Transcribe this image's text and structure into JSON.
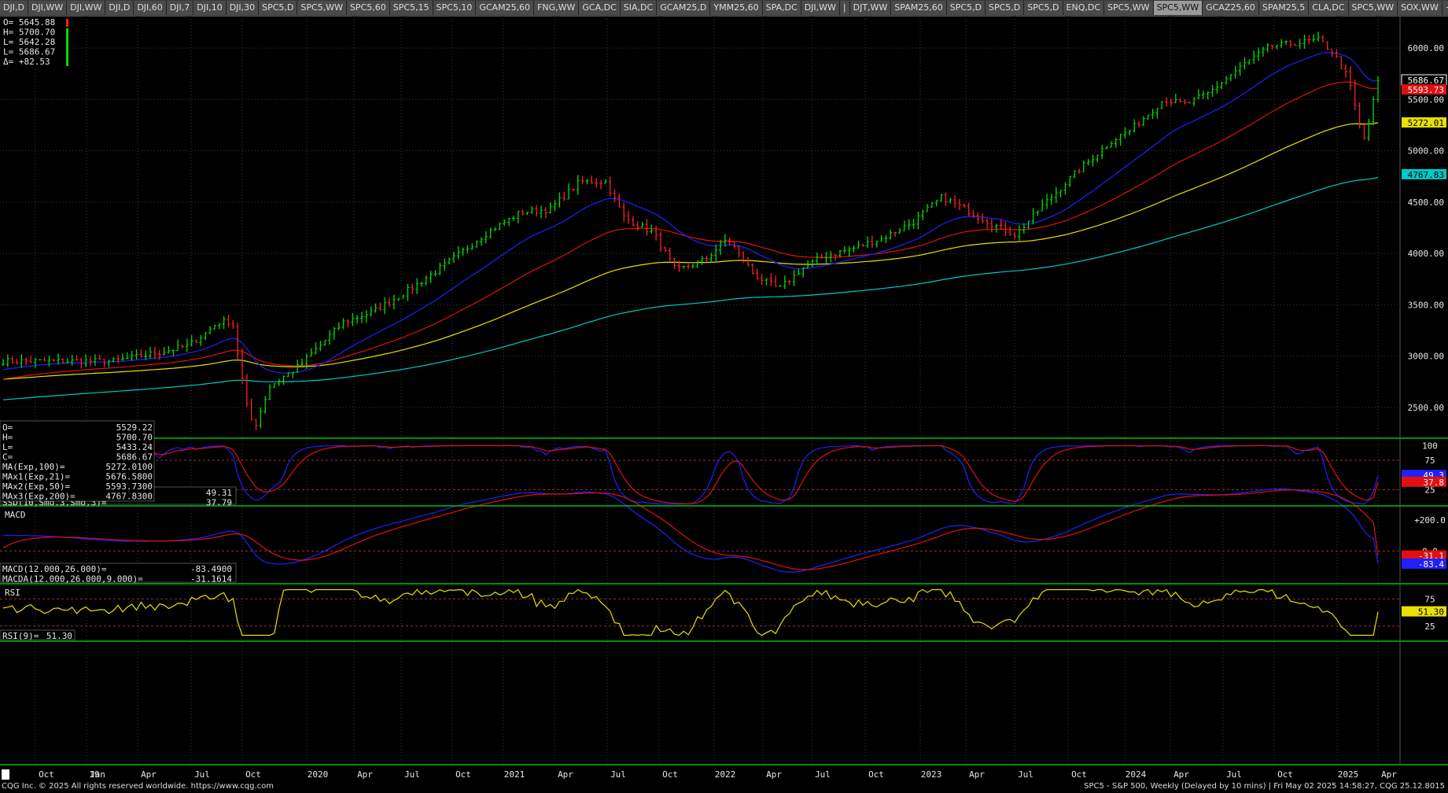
{
  "tabs": [
    "DJI,D",
    "DJI,WW",
    "DJI,WW",
    "DJI,D",
    "DJI,60",
    "DJI,7",
    "DJI,10",
    "DJI,30",
    "SPC5,D",
    "SPC5,WW",
    "SPC5,60",
    "SPC5,15",
    "SPC5,10",
    "GCAM25,60",
    "FNG,WW",
    "GCA,DC",
    "SIA,DC",
    "GCAM25,D",
    "YMM25,60",
    "SPA,DC",
    "DJI,WW",
    "|",
    "DJT,WW",
    "SPAM25,60",
    "SPC5,D",
    "SPC5,D",
    "SPC5,D",
    "ENQ,DC",
    "SPC5,WW",
    "SPC5,WW",
    "GCAZ25,60",
    "SPAM25,5",
    "CLA,DC",
    "SPC5,WW",
    "SOX,WW",
    "+"
  ],
  "active_tab": 29,
  "colors": {
    "up": "#00dd00",
    "down": "#ff2020",
    "ma21": "#2020ff",
    "ma50": "#e01010",
    "ma100": "#e8e000",
    "ma200": "#00c8c8",
    "grid": "#3a3a3a",
    "pane_border": "#00c000"
  },
  "ohlc_box": {
    "o": "O= 5645.88",
    "h": "H= 5700.70",
    "l": "L= 5642.28",
    "c": "L= 5686.67",
    "d": "Δ= +82.53"
  },
  "cursor_box": [
    [
      "O=",
      "5529.22"
    ],
    [
      "H=",
      "5700.70"
    ],
    [
      "L=",
      "5433.24"
    ],
    [
      "C=",
      "5686.67"
    ],
    [
      "MA(Exp,100)=",
      "5272.0100"
    ],
    [
      "MAx1(Exp,21)=",
      "5676.5800"
    ],
    [
      "MAx2(Exp,50)=",
      "5593.7300"
    ],
    [
      "MAx3(Exp,200)=",
      "4767.8300"
    ]
  ],
  "price_axis": [
    "6000.00",
    "5500.00",
    "5000.00",
    "4500.00",
    "4000.00",
    "3500.00",
    "3000.00",
    "2500.00"
  ],
  "price_tags": [
    {
      "value": "5686.67",
      "color": "#ffffff",
      "bg": "#000000",
      "border": "#ffffff"
    },
    {
      "value": "5593.73",
      "color": "#ffffff",
      "bg": "#e01010"
    },
    {
      "value": "5272.01",
      "color": "#000000",
      "bg": "#e8e000"
    },
    {
      "value": "4767.83",
      "color": "#000000",
      "bg": "#00c8c8"
    }
  ],
  "stoch": {
    "title": "SStoch",
    "legend": [
      [
        "SSK(10,Smo,3)=",
        "49.31"
      ],
      [
        "SSD(10,Smo,3,Smo,3)=",
        "37.79"
      ]
    ],
    "axis": [
      "100",
      "75",
      "25"
    ],
    "tags": [
      {
        "value": "49.3",
        "bg": "#2020ff"
      },
      {
        "value": "37.8",
        "bg": "#e01010"
      }
    ]
  },
  "macd": {
    "title": "MACD",
    "legend": [
      [
        "MACD(12.000,26.000)=",
        "-83.4900"
      ],
      [
        "MACDA(12.000,26.000,9.000)=",
        "-31.1614"
      ]
    ],
    "axis": [
      "+200.0",
      "0.0"
    ],
    "tags": [
      {
        "value": "-31.1",
        "bg": "#e01010"
      },
      {
        "value": "-83.4",
        "bg": "#2020ff"
      }
    ]
  },
  "rsi": {
    "title": "RSI",
    "legend": [
      [
        "RSI(9)=",
        "51.30"
      ]
    ],
    "axis": [
      "75",
      "25"
    ],
    "tags": [
      {
        "value": "51.30",
        "bg": "#e8e000"
      }
    ]
  },
  "time_axis": [
    "Oct",
    "Jan",
    "Apr",
    "Jul",
    "Oct",
    "2020",
    "Apr",
    "Jul",
    "Oct",
    "2021",
    "Apr",
    "Jul",
    "Oct",
    "2022",
    "Apr",
    "Jul",
    "Oct",
    "2023",
    "Apr",
    "Jul",
    "Oct",
    "2024",
    "Apr",
    "Jul",
    "Oct",
    "2025",
    "Apr"
  ],
  "time_axis_partial": "19",
  "footer": {
    "left": "CQG Inc. © 2025 All rights reserved worldwide. https://www.cqg.com",
    "right": "SPC5 - S&P 500, Weekly (Delayed by 10 mins) | Fri May 02 2025 14:58:27, CQG 25.12.8015"
  }
}
